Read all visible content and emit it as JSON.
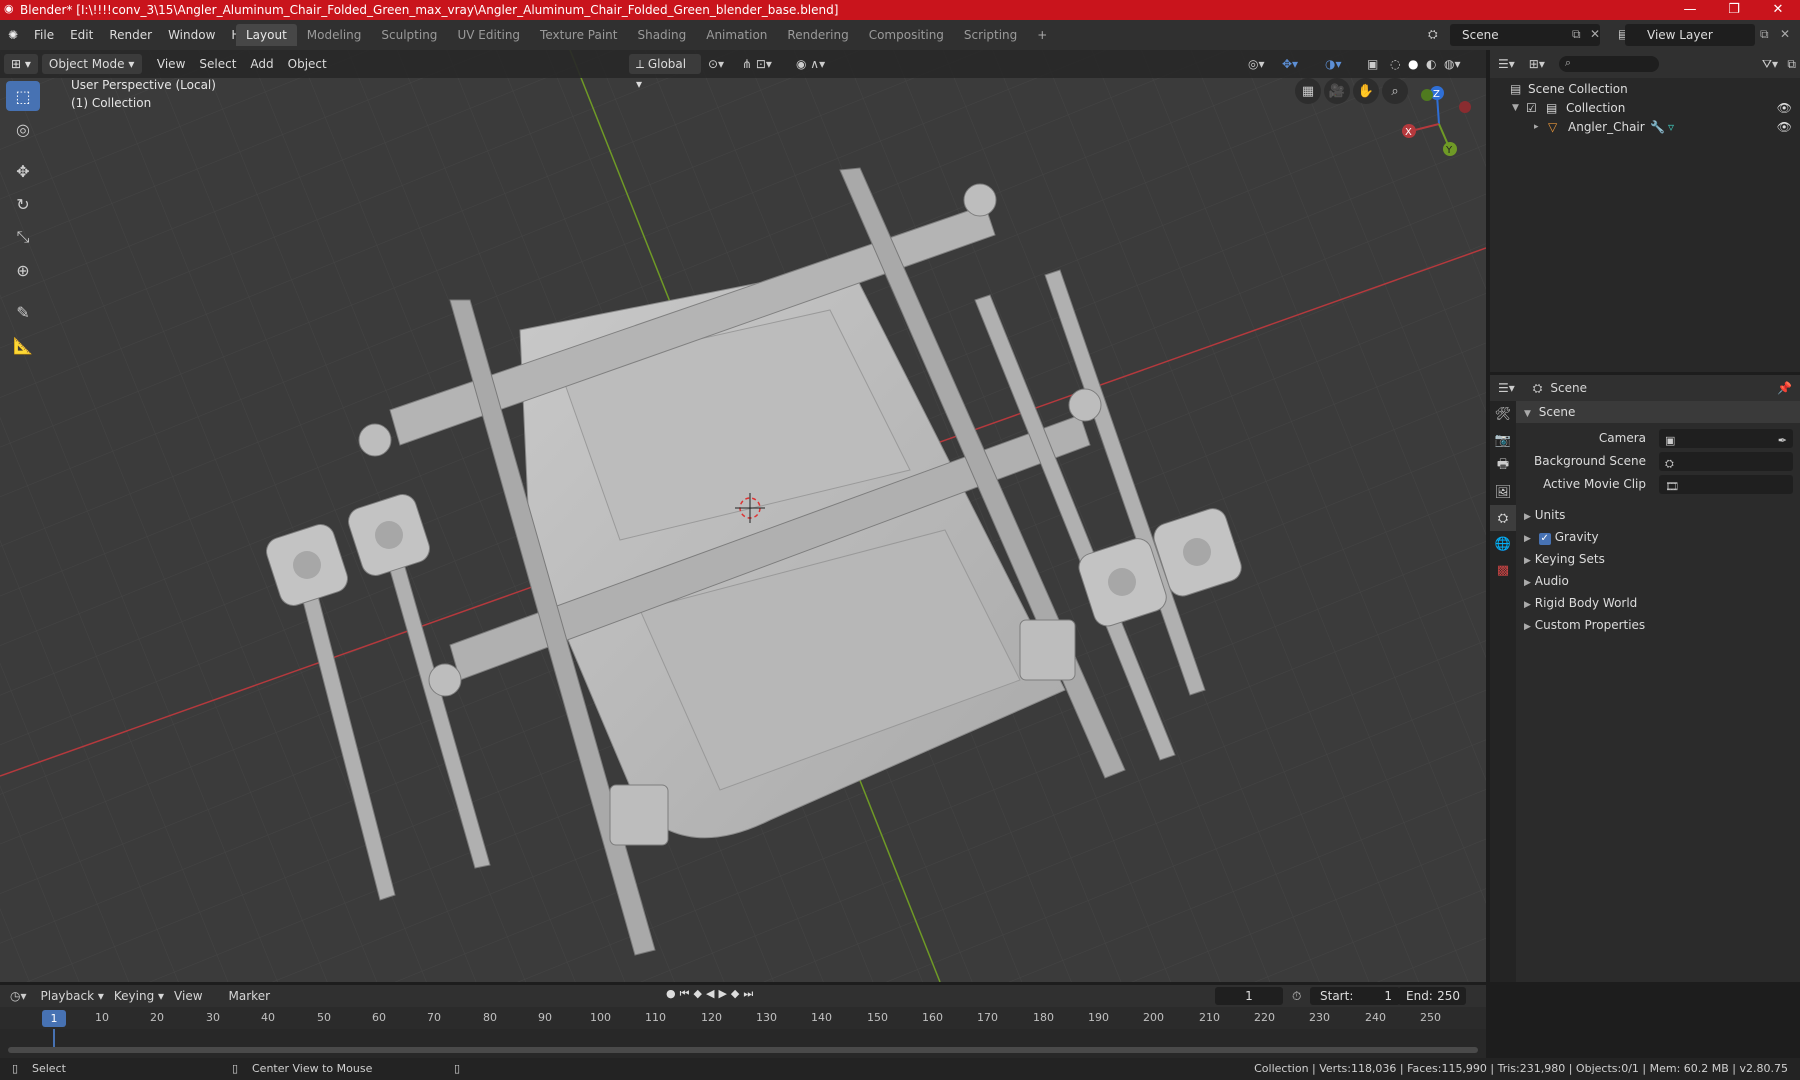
{
  "window": {
    "title": "Blender* [I:\\!!!!conv_3\\15\\Angler_Aluminum_Chair_Folded_Green_max_vray\\Angler_Aluminum_Chair_Folded_Green_blender_base.blend]",
    "controls": [
      "—",
      "❐",
      "✕"
    ]
  },
  "menu": [
    "File",
    "Edit",
    "Render",
    "Window",
    "Help"
  ],
  "workspaces": [
    "Layout",
    "Modeling",
    "Sculpting",
    "UV Editing",
    "Texture Paint",
    "Shading",
    "Animation",
    "Rendering",
    "Compositing",
    "Scripting"
  ],
  "workspace_add": "+",
  "scene": {
    "name": "Scene"
  },
  "view_layer": {
    "name": "View Layer"
  },
  "viewport": {
    "mode": "Object Mode",
    "menus": [
      "View",
      "Select",
      "Add",
      "Object"
    ],
    "transform_orientation": "Global",
    "overlay_line1": "User Perspective (Local)",
    "overlay_line2": "(1) Collection",
    "gizmo": {
      "x": "X",
      "y": "Y",
      "z": "Z"
    }
  },
  "outliner": {
    "root": "Scene Collection",
    "collection": "Collection",
    "object": "Angler_Chair",
    "search_placeholder": ""
  },
  "properties": {
    "context": "Scene",
    "section": "Scene",
    "fields": [
      {
        "label": "Camera"
      },
      {
        "label": "Background Scene"
      },
      {
        "label": "Active Movie Clip"
      }
    ],
    "panels": [
      "Units",
      "Gravity",
      "Keying Sets",
      "Audio",
      "Rigid Body World",
      "Custom Properties"
    ],
    "gravity_checked": true
  },
  "timeline": {
    "menus": [
      "Playback",
      "Keying",
      "View",
      "Marker"
    ],
    "current_frame": "1",
    "start_label": "Start:",
    "start": "1",
    "end_label": "End:",
    "end": "250",
    "ruler": [
      "1",
      "10",
      "20",
      "30",
      "40",
      "50",
      "60",
      "70",
      "80",
      "90",
      "100",
      "110",
      "120",
      "130",
      "140",
      "150",
      "160",
      "170",
      "180",
      "190",
      "200",
      "210",
      "220",
      "230",
      "240",
      "250"
    ]
  },
  "status": {
    "left": "Select",
    "middle": "Center View to Mouse",
    "right": "Collection | Verts:118,036 | Faces:115,990 | Tris:231,980 | Objects:0/1 | Mem: 60.2 MB | v2.80.75"
  },
  "colors": {
    "title_bar": "#c9141c",
    "accent": "#4772b3",
    "axis_x": "#b5393d",
    "axis_y": "#6f9a26",
    "axis_z": "#2f6fd6"
  }
}
